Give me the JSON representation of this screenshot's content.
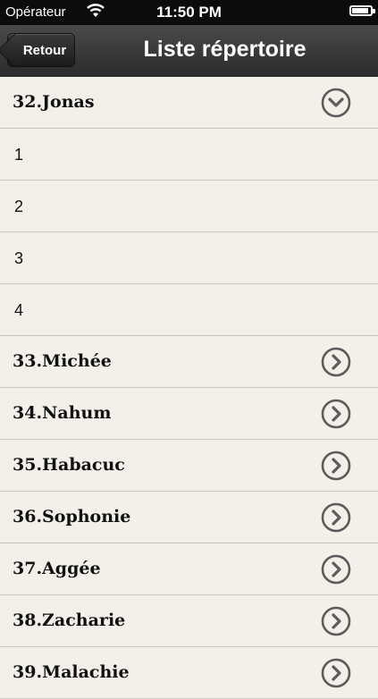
{
  "status_bar": {
    "carrier": "Opérateur",
    "time": "11:50 PM",
    "battery_level": 0.9
  },
  "nav": {
    "back_label": "Retour",
    "title": "Liste répertoire"
  },
  "rows": [
    {
      "label": "32.Jonas",
      "type": "expanded"
    },
    {
      "label": "1",
      "type": "sub"
    },
    {
      "label": "2",
      "type": "sub"
    },
    {
      "label": "3",
      "type": "sub"
    },
    {
      "label": "4",
      "type": "sub"
    },
    {
      "label": "33.Michée",
      "type": "collapsed"
    },
    {
      "label": "34.Nahum",
      "type": "collapsed"
    },
    {
      "label": "35.Habacuc",
      "type": "collapsed"
    },
    {
      "label": "36.Sophonie",
      "type": "collapsed"
    },
    {
      "label": "37.Aggée",
      "type": "collapsed"
    },
    {
      "label": "38.Zacharie",
      "type": "collapsed"
    },
    {
      "label": "39.Malachie",
      "type": "collapsed"
    }
  ],
  "icons": {
    "expanded": "chevron-down-circle-icon",
    "collapsed": "chevron-right-circle-icon"
  }
}
